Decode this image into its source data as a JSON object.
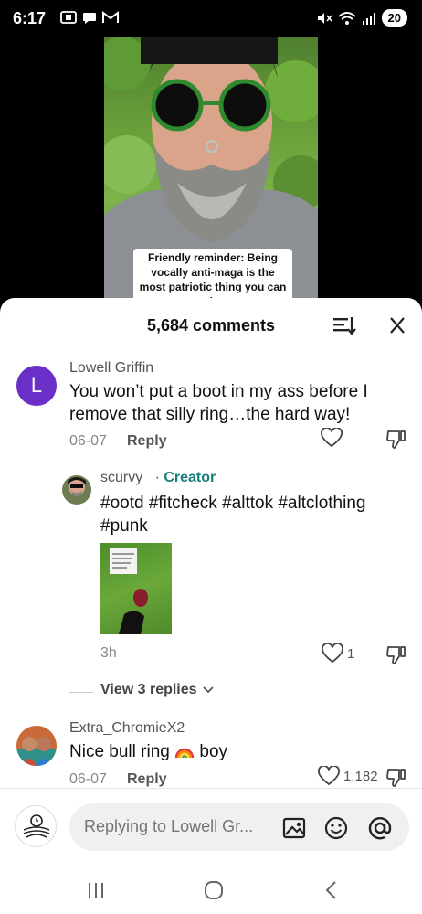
{
  "status_bar": {
    "time": "6:17",
    "battery": "20",
    "icons_left": [
      "screenshot-icon",
      "message-icon",
      "gmail-icon"
    ],
    "icons_right": [
      "mute-icon",
      "wifi-icon",
      "signal-icon"
    ]
  },
  "video": {
    "caption": "Friendly reminder: Being vocally anti-maga is the most patriotic thing you can do"
  },
  "comments_header": {
    "count_label": "5,684 comments"
  },
  "comments": [
    {
      "avatar_letter": "L",
      "username": "Lowell Griffin",
      "text": "You won’t put a boot in my ass before I remove that silly ring…the hard way!",
      "date": "06-07",
      "reply_label": "Reply"
    },
    {
      "username": "scurvy_",
      "separator": " · ",
      "creator_label": "Creator",
      "text": "#ootd #fitcheck #alttok #altclothing #punk",
      "date": "3h",
      "like_count": "1"
    },
    {
      "username": "Extra_ChromieX2",
      "text_before": "Nice bull ring ",
      "text_after": " boy",
      "date": "06-07",
      "reply_label": "Reply",
      "like_count": "1,182"
    }
  ],
  "view_replies_label": "View 3 replies",
  "input": {
    "placeholder": "Replying to Lowell Gr..."
  },
  "colors": {
    "avatar_purple": "#6a2fc7",
    "creator_teal": "#1a7f7a"
  }
}
